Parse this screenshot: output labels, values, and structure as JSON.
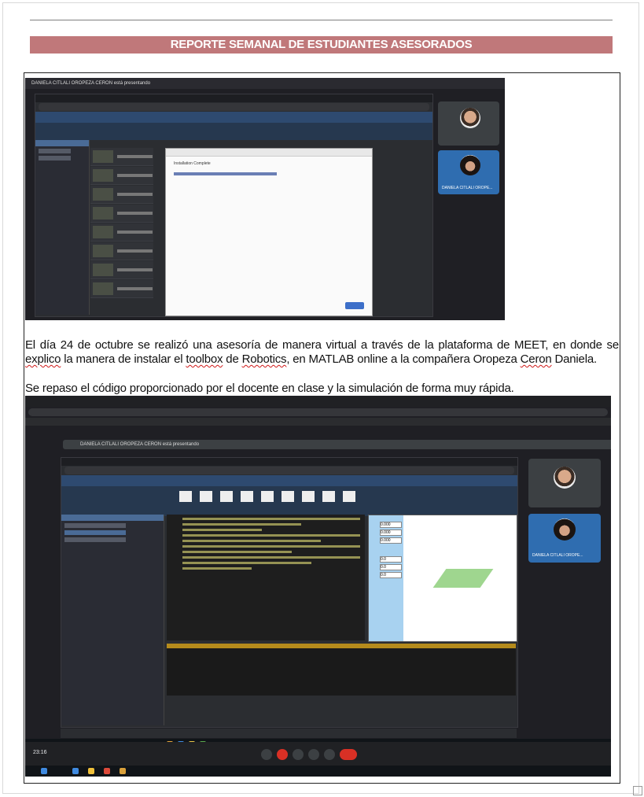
{
  "document": {
    "title": "REPORTE SEMANAL DE ESTUDIANTES ASESORADOS",
    "paragraph1_parts": [
      {
        "text": "El día 24 de octubre se realizó una asesoría de manera virtual a través de la plataforma de MEET, en donde se ",
        "squiggle": false
      },
      {
        "text": "explico",
        "squiggle": true
      },
      {
        "text": " la manera de instalar el ",
        "squiggle": false
      },
      {
        "text": "toolbox",
        "squiggle": true
      },
      {
        "text": " de ",
        "squiggle": false
      },
      {
        "text": "Robotics",
        "squiggle": true
      },
      {
        "text": ", en MATLAB online a la compañera Oropeza ",
        "squiggle": false
      },
      {
        "text": "Ceron",
        "squiggle": true
      },
      {
        "text": " Daniela.",
        "squiggle": false
      }
    ],
    "paragraph2": "Se repaso el código proporcionado por el docente en clase y la simulación de forma muy rápida."
  },
  "screenshot1": {
    "meet_header": "DANIELA CITLALI OROPEZA CERON está presentando",
    "dialog_heading": "Installation Complete",
    "participant_label": "DANIELA CITLALI OROPE..."
  },
  "screenshot2": {
    "meet_header": "DANIELA CITLALI OROPEZA CERON está presentando",
    "participant_label": "DANIELA CITLALI OROPE...",
    "figure_values": [
      "0.000",
      "0.000",
      "0.000",
      "0.0",
      "0.0",
      "0.0"
    ],
    "time_label": "23:16"
  },
  "colors": {
    "banner": "#c0787a",
    "squiggle": "#d01818"
  }
}
